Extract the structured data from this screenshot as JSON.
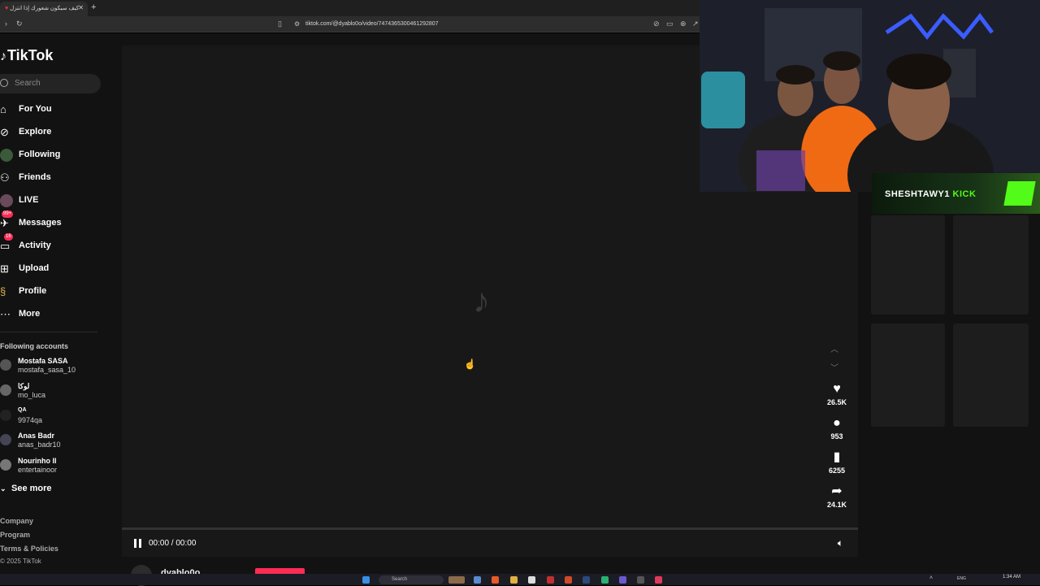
{
  "browser": {
    "tab_title": "كيف سيكون شعورك إذا انتزل",
    "url": "tiktok.com/@dyablo0o/video/7474365300461292807"
  },
  "tiktok": {
    "logo": "TikTok",
    "search_placeholder": "Search",
    "nav": [
      {
        "label": "For You",
        "icon": "home-icon"
      },
      {
        "label": "Explore",
        "icon": "compass-icon"
      },
      {
        "label": "Following",
        "icon": "following-icon"
      },
      {
        "label": "Friends",
        "icon": "friends-icon"
      },
      {
        "label": "LIVE",
        "icon": "live-icon"
      },
      {
        "label": "Messages",
        "icon": "messages-icon",
        "badge": "99+"
      },
      {
        "label": "Activity",
        "icon": "activity-icon",
        "badge": "16"
      },
      {
        "label": "Upload",
        "icon": "upload-icon"
      },
      {
        "label": "Profile",
        "icon": "profile-icon"
      },
      {
        "label": "More",
        "icon": "more-icon"
      }
    ],
    "following_title": "Following accounts",
    "following": [
      {
        "name": "Mostafa SASA",
        "handle": "mostafa_sasa_10"
      },
      {
        "name": "لوكا",
        "handle": "mo_luca"
      },
      {
        "name": "QA",
        "handle": "9974qa"
      },
      {
        "name": "Anas Badr",
        "handle": "anas_badr10"
      },
      {
        "name": "Nourinho II",
        "handle": "entertainoor"
      }
    ],
    "see_more": "See more",
    "footer": [
      "Company",
      "Program",
      "Terms & Policies",
      "© 2025 TikTok"
    ],
    "video": {
      "time": "00:00 / 00:00",
      "author": "dyablo0o"
    },
    "actions": [
      {
        "icon": "heart-icon",
        "count": "26.5K"
      },
      {
        "icon": "comment-icon",
        "count": "953"
      },
      {
        "icon": "bookmark-icon",
        "count": "6255"
      },
      {
        "icon": "share-icon",
        "count": "24.1K"
      }
    ]
  },
  "overlay": {
    "streamer": "SHESHTAWY1",
    "platform": "KICK"
  },
  "taskbar": {
    "search": "Search",
    "lang": "ENG",
    "time": "1:34 AM"
  },
  "colors": {
    "accent": "#fe2c55",
    "kick_green": "#53fc18"
  }
}
